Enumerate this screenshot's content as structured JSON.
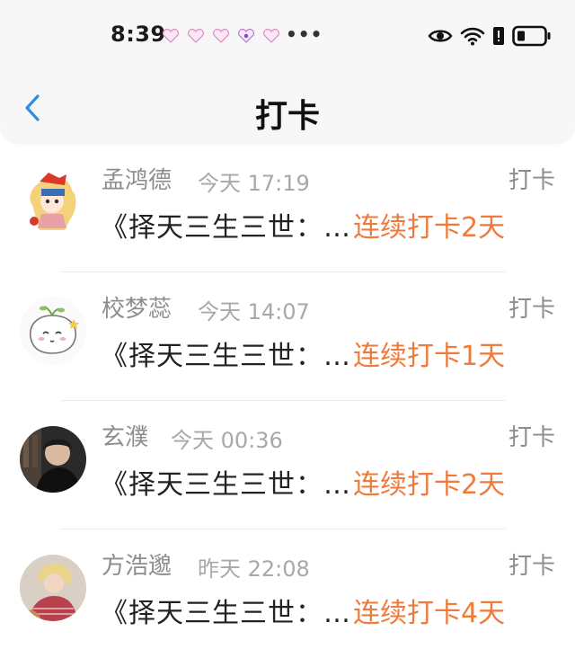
{
  "status_bar": {
    "time": "8:39",
    "dots": "•••",
    "icons": [
      "eye-icon",
      "wifi-icon",
      "battery-icon"
    ]
  },
  "header": {
    "back_icon": "chevron-left-icon",
    "title": "打卡"
  },
  "colors": {
    "accent": "#f07a3a",
    "back": "#2f8de4",
    "muted": "#8d8d8d"
  },
  "items": [
    {
      "name": "孟鸿德",
      "time": "今天 17:19",
      "action": "打卡",
      "book": "《择天三生三世：…",
      "streak": "连续打卡2天"
    },
    {
      "name": "校梦蕊",
      "time": "今天 14:07",
      "action": "打卡",
      "book": "《择天三生三世：…",
      "streak": "连续打卡1天"
    },
    {
      "name": "玄濮",
      "time": "今天 00:36",
      "action": "打卡",
      "book": "《择天三生三世：…",
      "streak": "连续打卡2天"
    },
    {
      "name": "方浩邈",
      "time": "昨天 22:08",
      "action": "打卡",
      "book": "《择天三生三世：…",
      "streak": "连续打卡4天"
    }
  ]
}
